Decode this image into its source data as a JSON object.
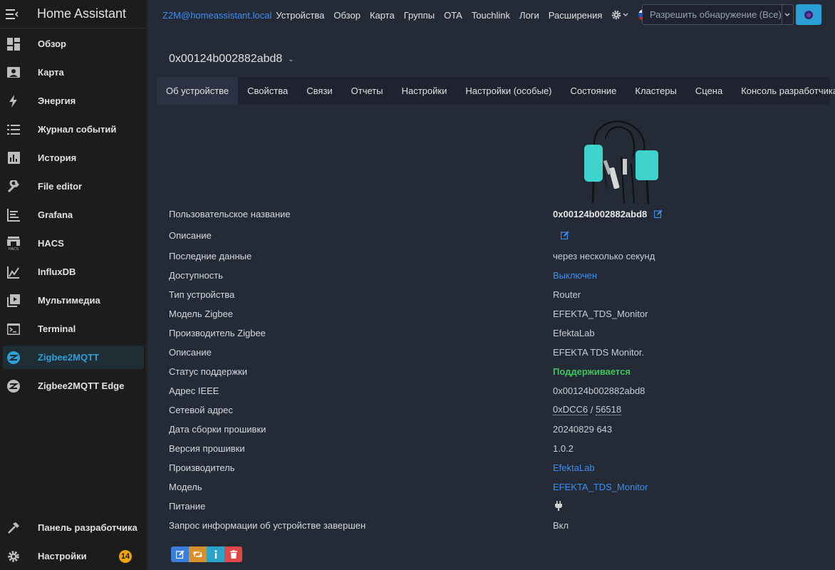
{
  "sidebar": {
    "title": "Home Assistant",
    "items": [
      {
        "label": "Обзор",
        "icon": "dashboard-icon"
      },
      {
        "label": "Карта",
        "icon": "map-icon"
      },
      {
        "label": "Энергия",
        "icon": "lightning-icon"
      },
      {
        "label": "Журнал событий",
        "icon": "list-icon"
      },
      {
        "label": "История",
        "icon": "chart-bar-icon"
      },
      {
        "label": "File editor",
        "icon": "wrench-icon"
      },
      {
        "label": "Grafana",
        "icon": "grafana-icon"
      },
      {
        "label": "HACS",
        "icon": "hacs-icon"
      },
      {
        "label": "InfluxDB",
        "icon": "chart-line-icon"
      },
      {
        "label": "Мультимедиа",
        "icon": "play-box-icon"
      },
      {
        "label": "Terminal",
        "icon": "terminal-icon"
      },
      {
        "label": "Zigbee2MQTT",
        "icon": "zigbee-icon"
      },
      {
        "label": "Zigbee2MQTT Edge",
        "icon": "zigbee-icon"
      }
    ],
    "bottom": [
      {
        "label": "Панель разработчика",
        "icon": "hammer-icon"
      },
      {
        "label": "Настройки",
        "icon": "cog-icon",
        "badge": "14"
      }
    ]
  },
  "topnav": {
    "brand": "Z2M@homeassistant.local",
    "links": [
      "Устройства",
      "Обзор",
      "Карта",
      "Группы",
      "OTA",
      "Touchlink",
      "Логи",
      "Расширения"
    ],
    "permit_select": "Разрешить обнаружение (Все)"
  },
  "device": {
    "title": "0x00124b002882abd8",
    "tabs": [
      "Об устройстве",
      "Свойства",
      "Связи",
      "Отчеты",
      "Настройки",
      "Настройки (особые)",
      "Состояние",
      "Кластеры",
      "Сцена",
      "Консоль разработчика"
    ],
    "rows": [
      {
        "label": "Пользовательское название",
        "value": "0x00124b002882abd8"
      },
      {
        "label": "Описание",
        "value": ""
      },
      {
        "label": "Последние данные",
        "value": "через несколько секунд"
      },
      {
        "label": "Доступность",
        "value": "Выключен"
      },
      {
        "label": "Тип устройства",
        "value": "Router"
      },
      {
        "label": "Модель Zigbee",
        "value": "EFEKTA_TDS_Monitor"
      },
      {
        "label": "Производитель Zigbee",
        "value": "EfektaLab"
      },
      {
        "label": "Описание",
        "value": "EFEKTA TDS Monitor."
      },
      {
        "label": "Статус поддержки",
        "value": "Поддерживается"
      },
      {
        "label": "Адрес IEEE",
        "value": "0x00124b002882abd8"
      },
      {
        "label": "Сетевой адрес",
        "value_hex": "0xDCC6",
        "value_sep": " / ",
        "value_dec": "56518"
      },
      {
        "label": "Дата сборки прошивки",
        "value": "20240829 643"
      },
      {
        "label": "Версия прошивки",
        "value": "1.0.2"
      },
      {
        "label": "Производитель",
        "value": "EfektaLab"
      },
      {
        "label": "Модель",
        "value": "EFEKTA_TDS_Monitor"
      },
      {
        "label": "Питание",
        "value": ""
      },
      {
        "label": "Запрос информации об устройстве завершен",
        "value": "Вкл"
      }
    ]
  },
  "colors": {
    "accent": "#2a9fd6",
    "link": "#3b8ff0",
    "success": "#3ec55b",
    "danger": "#e04848",
    "warning": "#d9902a"
  }
}
